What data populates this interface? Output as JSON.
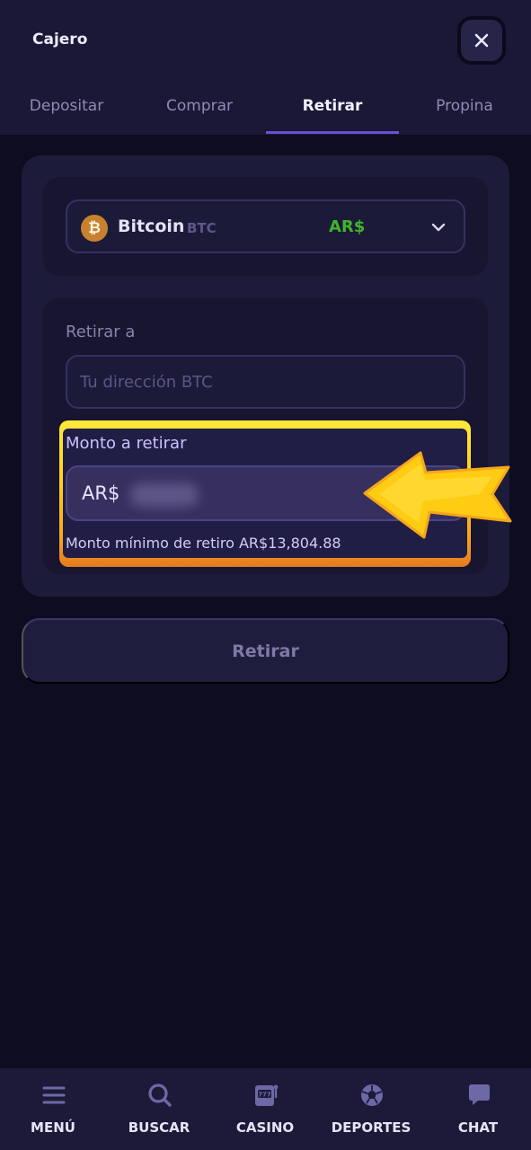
{
  "header": {
    "title": "Cajero",
    "close_label": "✕"
  },
  "tabs": [
    {
      "label": "Depositar",
      "active": false
    },
    {
      "label": "Comprar",
      "active": false
    },
    {
      "label": "Retirar",
      "active": true
    },
    {
      "label": "Propina",
      "active": false
    }
  ],
  "currency": {
    "icon_glyph": "₿",
    "name": "Bitcoin",
    "ticker": "BTC",
    "fiat": "AR$",
    "chevron": "chevron-down-icon"
  },
  "withdraw": {
    "to_label": "Retirar a",
    "address_placeholder": "Tu dirección BTC",
    "address_value": "",
    "amount_label": "Monto a retirar",
    "amount_prefix": "AR$",
    "min_note": "Monto mínimo de retiro AR$13,804.88",
    "submit_label": "Retirar"
  },
  "bottom_nav": [
    {
      "label": "MENÚ",
      "icon": "menu-icon"
    },
    {
      "label": "BUSCAR",
      "icon": "search-icon"
    },
    {
      "label": "CASINO",
      "icon": "slot-machine-icon"
    },
    {
      "label": "DEPORTES",
      "icon": "soccer-ball-icon"
    },
    {
      "label": "CHAT",
      "icon": "chat-icon"
    }
  ],
  "colors": {
    "accent": "#6b4fd1",
    "fiat_green": "#3fb52a",
    "highlight_yellow": "#ffd11c",
    "highlight_orange": "#e57a22"
  }
}
